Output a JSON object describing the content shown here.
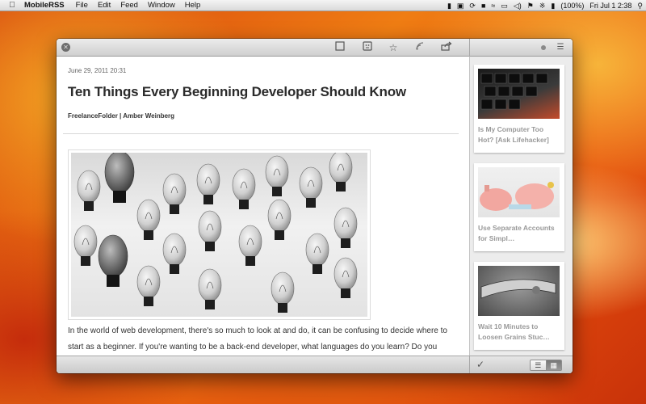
{
  "menubar": {
    "app_name": "MobileRSS",
    "menus": [
      "File",
      "Edit",
      "Feed",
      "Window",
      "Help"
    ],
    "battery": "(100%)",
    "clock": "Fri Jul 1  2:38"
  },
  "article": {
    "date": "June 29, 2011 20:31",
    "title": "Ten Things Every Beginning Developer Should Know",
    "byline": "FreelanceFolder | Amber Weinberg",
    "body": "In the world of web development, there's so much to look at and do, it can be confusing to decide where to start as a beginner. If you're wanting to be a back-end developer, what languages do you learn? Do you"
  },
  "sidebar": {
    "items": [
      {
        "caption": "Is My Computer Too Hot? [Ask Lifehacker]"
      },
      {
        "caption": "Use Separate Accounts for Simpl…"
      },
      {
        "caption": "Wait 10 Minutes to Loosen Grains Stuc…"
      }
    ]
  },
  "toolbar": {
    "icons": [
      "close-icon",
      "mark-read-icon",
      "view-icon",
      "star-icon",
      "feed-icon",
      "share-icon",
      "dot-icon",
      "list-icon"
    ]
  },
  "bottombar": {
    "check": "✓",
    "views": [
      "list-view",
      "grid-view"
    ]
  },
  "colors": {
    "title": "#2b2b2b",
    "caption": "#999999",
    "sidebar_bg": "#ececec"
  }
}
